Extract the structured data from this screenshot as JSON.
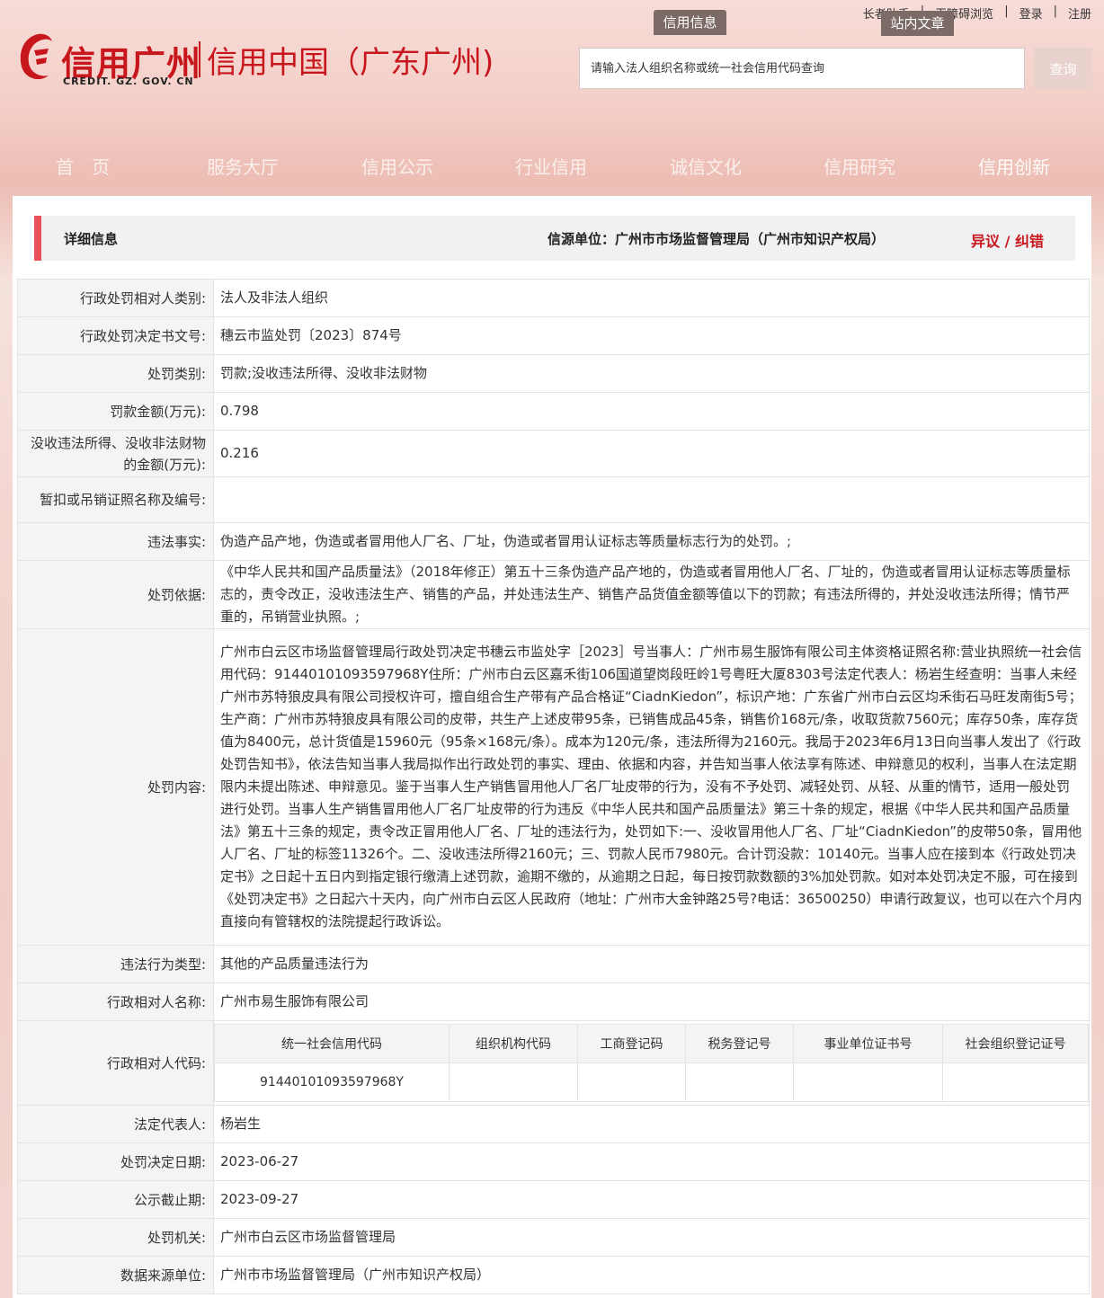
{
  "header": {
    "logo_main": "信用广州",
    "logo_sub": "信用中国（广东广州)",
    "logo_domain": "CREDIT. GZ. GOV. CN",
    "top_links": [
      "长者助手",
      "无障碍浏览",
      "登录",
      "注册"
    ],
    "tab_credit": "信用信息",
    "tab_site": "站内文章",
    "search_placeholder": "请输入法人组织名称或统一社会信用代码查询",
    "search_button": "查询"
  },
  "nav": [
    "首　页",
    "服务大厅",
    "信用公示",
    "行业信用",
    "诚信文化",
    "信用研究",
    "信用创新"
  ],
  "detail": {
    "title": "详细信息",
    "source": "信源单位：广州市市场监督管理局（广州市知识产权局）",
    "error_link": "异议 / 纠错"
  },
  "rows": [
    {
      "label": "行政处罚相对人类别:",
      "value": "法人及非法人组织"
    },
    {
      "label": "行政处罚决定书文号:",
      "value": "穗云市监处罚〔2023〕874号"
    },
    {
      "label": "处罚类别:",
      "value": "罚款;没收违法所得、没收非法财物"
    },
    {
      "label": "罚款金额(万元):",
      "value": "0.798"
    },
    {
      "label": "没收违法所得、没收非法财物的金额(万元):",
      "value": "0.216"
    },
    {
      "label": "暂扣或吊销证照名称及编号:",
      "value": ""
    },
    {
      "label": "违法事实:",
      "value": "伪造产品产地，伪造或者冒用他人厂名、厂址，伪造或者冒用认证标志等质量标志行为的处罚。;"
    },
    {
      "label": "处罚依据:",
      "value": "《中华人民共和国产品质量法》（2018年修正）第五十三条伪造产品产地的，伪造或者冒用他人厂名、厂址的，伪造或者冒用认证标志等质量标志的，责令改正，没收违法生产、销售的产品，并处违法生产、销售产品货值金额等值以下的罚款；有违法所得的，并处没收违法所得；情节严重的，吊销营业执照。;"
    },
    {
      "label": "处罚内容:",
      "value": "广州市白云区市场监督管理局行政处罚决定书穗云市监处字［2023］号当事人：广州市易生服饰有限公司主体资格证照名称:营业执照统一社会信用代码：91440101093597968Y住所：广州市白云区嘉禾街106国道望岗段旺岭1号粤旺大厦8303号法定代表人：杨岩生经查明：当事人未经广州市苏特狼皮具有限公司授权许可，擅自组合生产带有产品合格证“CiadnKiedon”，标识产地：广东省广州市白云区均禾街石马旺发南街5号；生产商：广州市苏特狼皮具有限公司的皮带，共生产上述皮带95条，已销售成品45条，销售价168元/条，收取货款7560元；库存50条，库存货值为8400元，总计货值是15960元（95条×168元/条）。成本为120元/条，违法所得为2160元。我局于2023年6月13日向当事人发出了《行政处罚告知书》，依法告知当事人我局拟作出行政处罚的事实、理由、依据和内容，并告知当事人依法享有陈述、申辩意见的权利，当事人在法定期限内未提出陈述、申辩意见。鉴于当事人生产销售冒用他人厂名厂址皮带的行为，没有不予处罚、减轻处罚、从轻、从重的情节，适用一般处罚进行处罚。当事人生产销售冒用他人厂名厂址皮带的行为违反《中华人民共和国产品质量法》第三十条的规定，根据《中华人民共和国产品质量法》第五十三条的规定，责令改正冒用他人厂名、厂址的违法行为，处罚如下:一、没收冒用他人厂名、厂址“CiadnKiedon”的皮带50条，冒用他人厂名、厂址的标签11326个。二、没收违法所得2160元；三、罚款人民币7980元。合计罚没款：10140元。当事人应在接到本《行政处罚决定书》之日起十五日内到指定银行缴清上述罚款，逾期不缴的，从逾期之日起，每日按罚款数额的3%加处罚款。如对本处罚决定不服，可在接到《处罚决定书》之日起六十天内，向广州市白云区人民政府（地址：广州市大金钟路25号?电话：36500250）申请行政复议，也可以在六个月内直接向有管辖权的法院提起行政诉讼。"
    },
    {
      "label": "违法行为类型:",
      "value": "其他的产品质量违法行为"
    },
    {
      "label": "行政相对人名称:",
      "value": "广州市易生服饰有限公司"
    }
  ],
  "code_row": {
    "label": "行政相对人代码:",
    "headers": [
      "统一社会信用代码",
      "组织机构代码",
      "工商登记码",
      "税务登记号",
      "事业单位证书号",
      "社会组织登记证号"
    ],
    "values": [
      "91440101093597968Y",
      "",
      "",
      "",
      "",
      ""
    ]
  },
  "rows_after": [
    {
      "label": "法定代表人:",
      "value": "杨岩生"
    },
    {
      "label": "处罚决定日期:",
      "value": "2023-06-27"
    },
    {
      "label": "公示截止期:",
      "value": "2023-09-27"
    },
    {
      "label": "处罚机关:",
      "value": "广州市白云区市场监督管理局"
    },
    {
      "label": "数据来源单位:",
      "value": "广州市市场监督管理局（广州市知识产权局）"
    }
  ],
  "colors": {
    "brand_red": "#c8161d",
    "accent_bar": "#e8505b"
  }
}
